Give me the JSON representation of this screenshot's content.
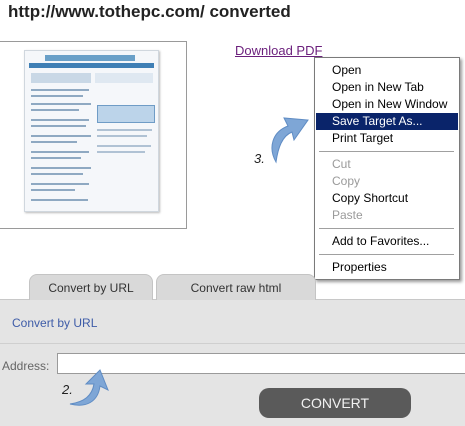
{
  "header": {
    "title": "http://www.tothepc.com/ converted"
  },
  "preview": {
    "alt": "converted page thumbnail"
  },
  "download": {
    "label": "Download PDF"
  },
  "context_menu": {
    "items": [
      {
        "label": "Open",
        "state": "normal"
      },
      {
        "label": "Open in New Tab",
        "state": "normal"
      },
      {
        "label": "Open in New Window",
        "state": "normal"
      },
      {
        "label": "Save Target As...",
        "state": "selected"
      },
      {
        "label": "Print Target",
        "state": "normal"
      },
      {
        "label": "Cut",
        "state": "disabled"
      },
      {
        "label": "Copy",
        "state": "disabled"
      },
      {
        "label": "Copy Shortcut",
        "state": "normal"
      },
      {
        "label": "Paste",
        "state": "disabled"
      },
      {
        "label": "Add to Favorites...",
        "state": "normal"
      },
      {
        "label": "Properties",
        "state": "normal"
      }
    ]
  },
  "steps": {
    "step2": "2.",
    "step3": "3."
  },
  "tabs": [
    {
      "label": "Convert by URL"
    },
    {
      "label": "Convert raw html"
    }
  ],
  "panel": {
    "title": "Convert by URL",
    "address_label": "Address:",
    "address_value": "",
    "convert_label": "CONVERT"
  },
  "colors": {
    "menu_highlight": "#0a246a",
    "link": "#6b1f7c",
    "panel_bg": "#e4e4e4",
    "button": "#5a5a5a",
    "arrow": "#7ea6d6"
  }
}
